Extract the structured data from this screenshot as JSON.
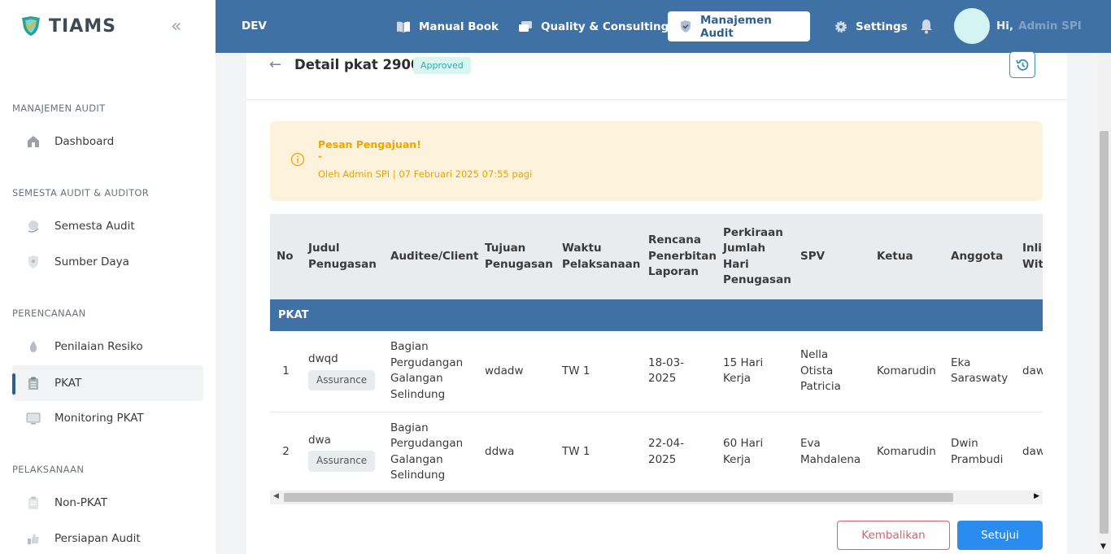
{
  "sidebar": {
    "brand": "TIAMS",
    "collapse_icon": "«",
    "sections": [
      "MANAJEMEN AUDIT",
      "SEMESTA AUDIT & AUDITOR",
      "PERENCANAAN",
      "PELAKSANAAN"
    ],
    "items": [
      {
        "label": "Dashboard",
        "icon": "home-icon"
      },
      {
        "label": "Semesta Audit",
        "icon": "globe-icon"
      },
      {
        "label": "Sumber Daya",
        "icon": "shield-icon"
      },
      {
        "label": "Penilaian Resiko",
        "icon": "drop-icon"
      },
      {
        "label": "PKAT",
        "icon": "clipboard-icon",
        "active": true
      },
      {
        "label": "Monitoring PKAT",
        "icon": "monitor-icon"
      },
      {
        "label": "Non-PKAT",
        "icon": "clipboard-icon"
      },
      {
        "label": "Persiapan Audit",
        "icon": "thumb-icon"
      }
    ]
  },
  "topbar": {
    "env": "DEV",
    "nav": [
      {
        "label": "Manual Book",
        "icon": "book-icon"
      },
      {
        "label": "Quality & Consulting",
        "icon": "chat-icon"
      },
      {
        "label": "Manajemen Audit",
        "icon": "shield-check-icon",
        "active": true
      },
      {
        "label": "Settings",
        "icon": "gear-icon"
      }
    ],
    "greeting": "Hi,",
    "user_name": "Admin SPI"
  },
  "page": {
    "back_icon": "←",
    "title": "Detail pkat 2900",
    "status_badge": "Approved",
    "alert": {
      "title": "Pesan Pengajuan!",
      "message": "-",
      "meta": "Oleh Admin SPI | 07 Februari 2025 07:55 pagi"
    },
    "table": {
      "headers": [
        "No",
        "Judul Penugasan",
        "Auditee/Client",
        "Tujuan Penugasan",
        "Waktu Pelaksanaan",
        "Rencana Penerbitan Laporan",
        "Perkiraan Jumlah Hari Penugasan",
        "SPV",
        "Ketua",
        "Anggota",
        "Inline With"
      ],
      "group": "PKAT",
      "rows": [
        {
          "no": "1",
          "judul": "dwqd",
          "tag": "Assurance",
          "auditee": "Bagian Pergudangan Galangan Selindung",
          "tujuan": "wdadw",
          "waktu": "TW 1",
          "rencana": "18-03-2025",
          "hari": "15 Hari Kerja",
          "spv": "Nella Otista Patricia",
          "ketua": "Komarudin",
          "anggota": "Eka Saraswaty",
          "inline": "daw"
        },
        {
          "no": "2",
          "judul": "dwa",
          "tag": "Assurance",
          "auditee": "Bagian Pergudangan Galangan Selindung",
          "tujuan": "ddwa",
          "waktu": "TW 1",
          "rencana": "22-04-2025",
          "hari": "60 Hari Kerja",
          "spv": "Eva Mahdalena",
          "ketua": "Komarudin",
          "anggota": "Dwin Prambudi",
          "inline": "daw"
        }
      ]
    },
    "buttons": {
      "return": "Kembalikan",
      "approve": "Setujui"
    }
  },
  "colors": {
    "primary": "#3f71a4",
    "accent": "#2b8cf0",
    "danger": "#e35d6a",
    "warning_bg": "#fdf3dc",
    "warning_text": "#f0a500",
    "badge_bg": "#d9f6f3",
    "badge_text": "#28b3a8"
  }
}
